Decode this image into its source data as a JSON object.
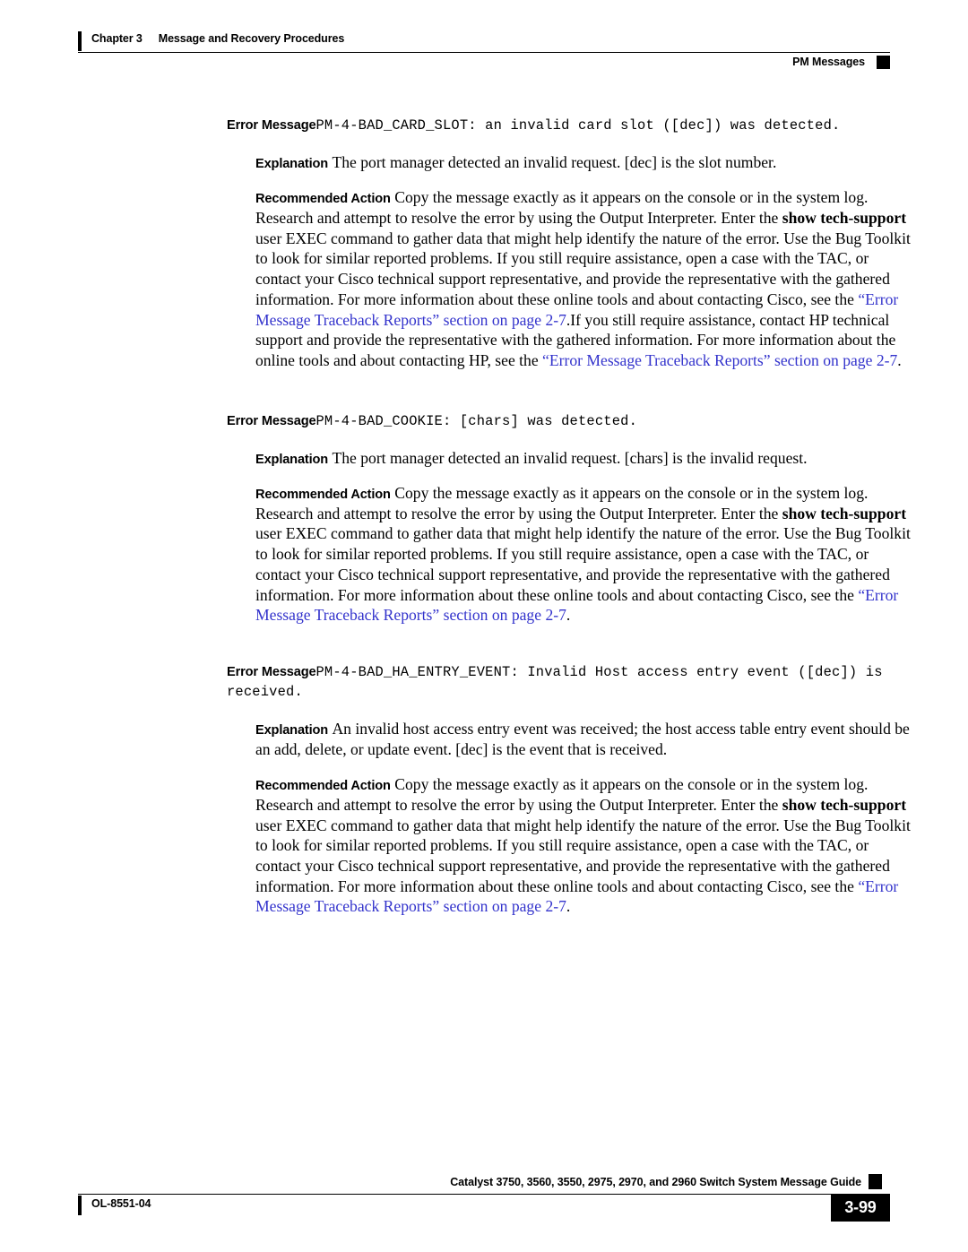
{
  "header": {
    "chapter": "Chapter 3",
    "chapter_title": "Message and Recovery Procedures",
    "section": "PM Messages"
  },
  "labels": {
    "error_message": "Error Message",
    "explanation": "Explanation",
    "recommended_action": "Recommended Action"
  },
  "messages": [
    {
      "code": "PM-4-BAD_CARD_SLOT: an invalid card slot ([dec]) was detected.",
      "explanation": "The port manager detected an invalid request. [dec] is the slot number.",
      "action": {
        "seg1": "Copy the message exactly as it appears on the console or in the system log. Research and attempt to resolve the error by using the Output Interpreter. Enter the ",
        "cmd1": "show tech-support",
        "seg2": " user EXEC command to gather data that might help identify the nature of the error. Use the Bug Toolkit to look for similar reported problems. If you still require assistance, open a case with the TAC, or contact your Cisco technical support representative, and provide the representative with the gathered information. For more information about these online tools and about contacting Cisco, see the ",
        "link1": "“Error Message Traceback Reports” section on page 2-7",
        "seg3": ".If you still require assistance, contact HP technical support and provide the representative with the gathered information. For more information about the online tools and about contacting HP, see the ",
        "link2": "“Error Message Traceback Reports” section on page 2-7",
        "seg4": "."
      }
    },
    {
      "code": "PM-4-BAD_COOKIE: [chars] was detected.",
      "explanation": "The port manager detected an invalid request. [chars] is the invalid request.",
      "action": {
        "seg1": "Copy the message exactly as it appears on the console or in the system log. Research and attempt to resolve the error by using the Output Interpreter. Enter the ",
        "cmd1": "show tech-support",
        "seg2": " user EXEC command to gather data that might help identify the nature of the error. Use the Bug Toolkit to look for similar reported problems. If you still require assistance, open a case with the TAC, or contact your Cisco technical support representative, and provide the representative with the gathered information. For more information about these online tools and about contacting Cisco, see the ",
        "link1": "“Error Message Traceback Reports” section on page 2-7",
        "seg3": "."
      }
    },
    {
      "code": "PM-4-BAD_HA_ENTRY_EVENT: Invalid Host access entry event ([dec]) is received.",
      "explanation": "An invalid host access entry event was received; the host access table entry event should be an add, delete, or update event. [dec] is the event that is received.",
      "action": {
        "seg1": "Copy the message exactly as it appears on the console or in the system log. Research and attempt to resolve the error by using the Output Interpreter. Enter the ",
        "cmd1": "show tech-support",
        "seg2": " user EXEC command to gather data that might help identify the nature of the error. Use the Bug Toolkit to look for similar reported problems. If you still require assistance, open a case with the TAC, or contact your Cisco technical support representative, and provide the representative with the gathered information. For more information about these online tools and about contacting Cisco, see the ",
        "link1": "“Error Message Traceback Reports” section on page 2-7",
        "seg3": "."
      }
    }
  ],
  "footer": {
    "doc_title": "Catalyst 3750, 3560, 3550, 2975, 2970, and 2960 Switch System Message Guide",
    "doc_id": "OL-8551-04",
    "page_number": "3-99"
  },
  "colors": {
    "link": "#3333cc",
    "text": "#000000",
    "rule": "#000000"
  }
}
